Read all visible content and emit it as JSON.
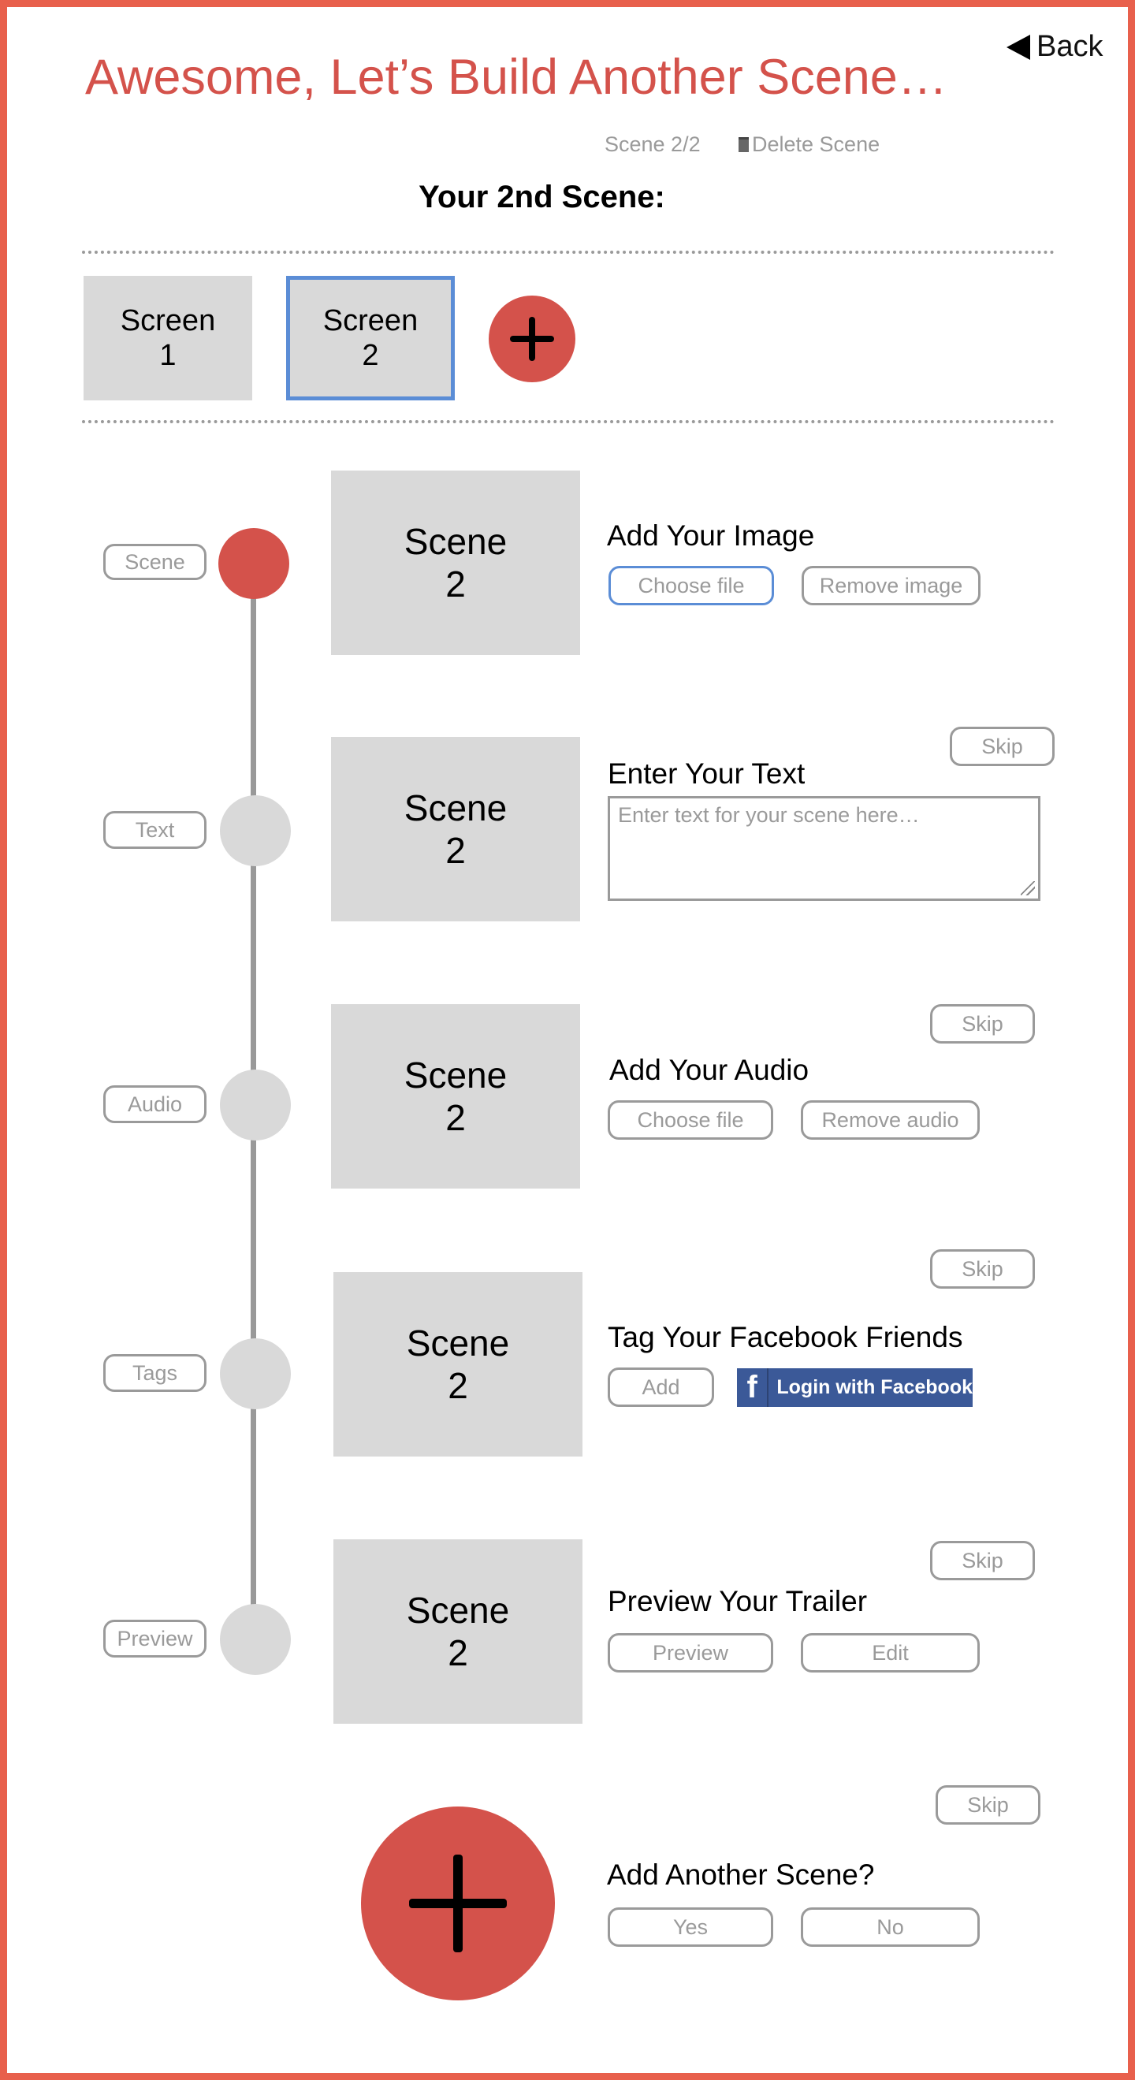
{
  "header": {
    "title": "Awesome, Let’s Build Another Scene…",
    "back_label": "Back",
    "scene_counter": "Scene 2/2",
    "delete_label": "Delete Scene",
    "subtitle": "Your 2nd Scene:"
  },
  "screens": {
    "items": [
      {
        "line1": "Screen",
        "line2": "1",
        "selected": false
      },
      {
        "line1": "Screen",
        "line2": "2",
        "selected": true
      }
    ]
  },
  "timeline": {
    "steps": [
      {
        "pill": "Scene",
        "panel_line1": "Scene",
        "panel_line2": "2",
        "heading": "Add Your Image",
        "buttons": [
          "Choose file",
          "Remove image"
        ],
        "active": true
      },
      {
        "pill": "Text",
        "panel_line1": "Scene",
        "panel_line2": "2",
        "heading": "Enter Your Text",
        "skip": "Skip",
        "textarea_placeholder": "Enter text for your scene here…"
      },
      {
        "pill": "Audio",
        "panel_line1": "Scene",
        "panel_line2": "2",
        "heading": "Add Your Audio",
        "skip": "Skip",
        "buttons": [
          "Choose file",
          "Remove audio"
        ]
      },
      {
        "pill": "Tags",
        "panel_line1": "Scene",
        "panel_line2": "2",
        "heading": "Tag Your Facebook Friends",
        "skip": "Skip",
        "buttons": [
          "Add"
        ],
        "facebook_icon": "f",
        "facebook_label": "Login with Facebook"
      },
      {
        "pill": "Preview",
        "panel_line1": "Scene",
        "panel_line2": "2",
        "heading": "Preview Your Trailer",
        "skip": "Skip",
        "buttons": [
          "Preview",
          "Edit"
        ]
      }
    ]
  },
  "footer": {
    "skip": "Skip",
    "heading": "Add Another Scene?",
    "yes": "Yes",
    "no": "No"
  },
  "colors": {
    "accent": "#d4524b",
    "frame": "#e8604c",
    "selected_border": "#5b8dd6",
    "facebook": "#3b5998",
    "placeholder_grey": "#d9d9d9"
  }
}
